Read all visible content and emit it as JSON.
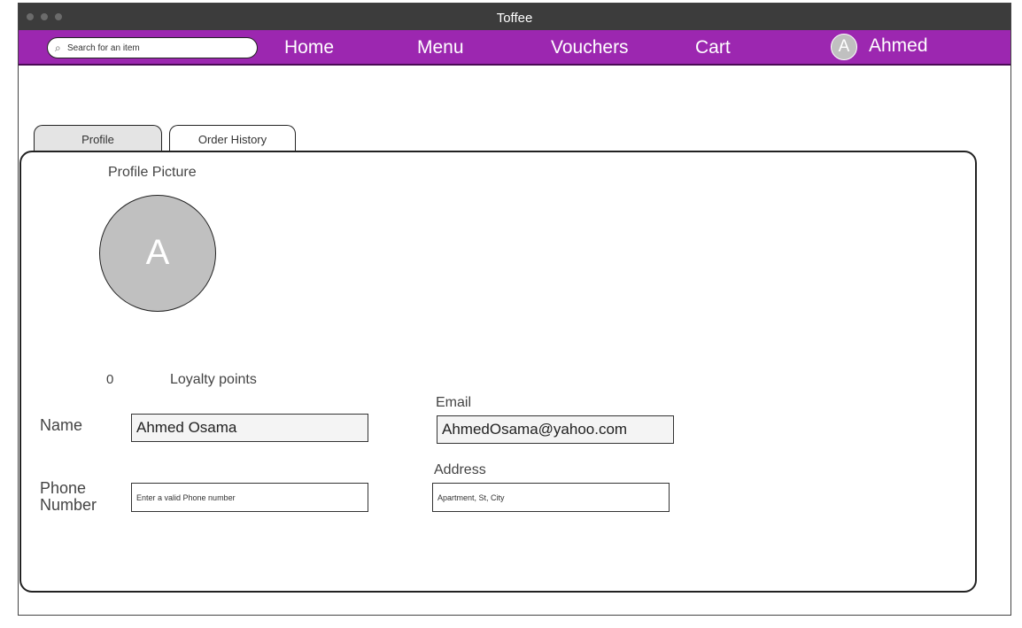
{
  "window": {
    "title": "Toffee"
  },
  "nav": {
    "search_placeholder": "Search for an item",
    "links": [
      "Home",
      "Menu",
      "Vouchers",
      "Cart"
    ],
    "avatar_initial": "A",
    "user_name": "Ahmed"
  },
  "tabs": [
    {
      "label": "Profile",
      "active": true
    },
    {
      "label": "Order History",
      "active": false
    }
  ],
  "profile": {
    "picture_label": "Profile Picture",
    "avatar_initial": "A",
    "loyalty_points": "0",
    "loyalty_label": "Loyalty points",
    "name_label": "Name",
    "name_value": "Ahmed Osama",
    "email_label": "Email",
    "email_value": "AhmedOsama@yahoo.com",
    "phone_label": "Phone Number",
    "phone_placeholder": "Enter a valid Phone number",
    "address_label": "Address",
    "address_placeholder": "Apartment, St, City"
  },
  "colors": {
    "nav_purple": "#9c27b0",
    "titlebar": "#3c3c3c",
    "avatar_gray": "#c0c0c0"
  }
}
